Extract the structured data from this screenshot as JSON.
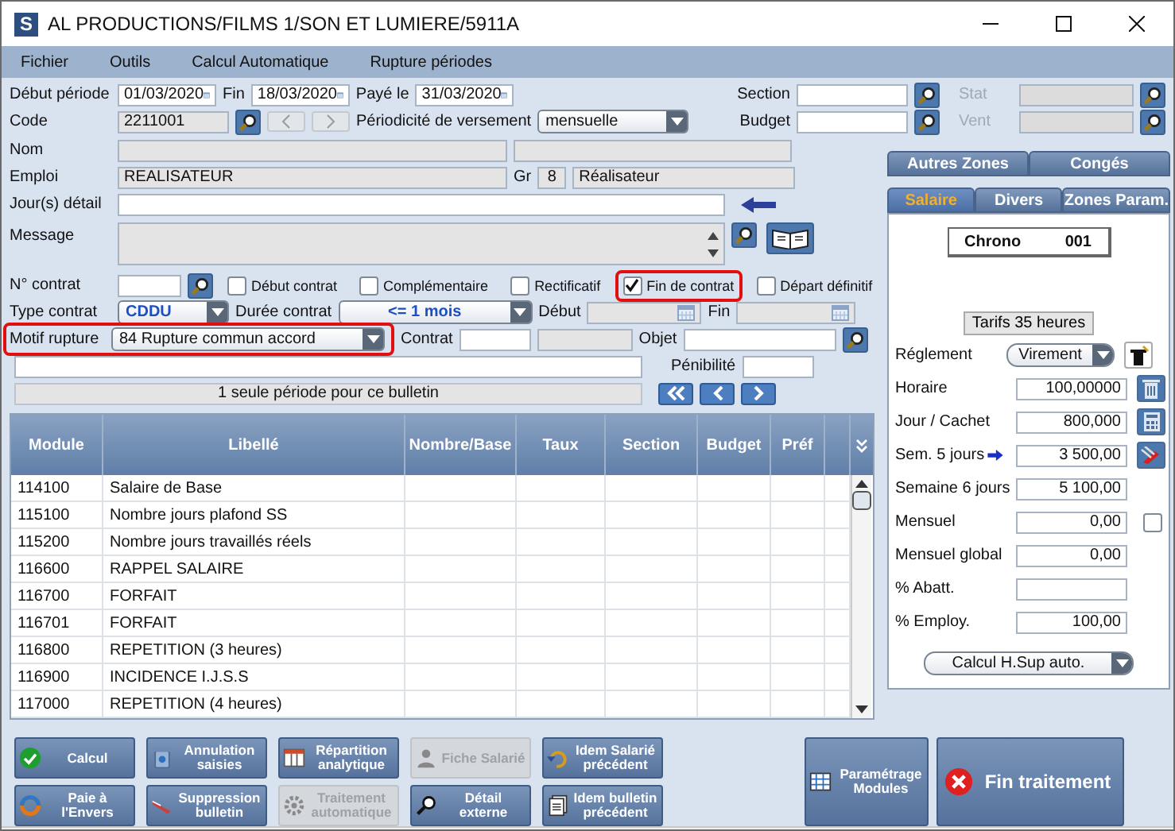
{
  "window": {
    "title": "AL PRODUCTIONS/FILMS 1/SON ET LUMIERE/5911A",
    "app_icon": "S"
  },
  "menu": [
    "Fichier",
    "Outils",
    "Calcul Automatique",
    "Rupture périodes"
  ],
  "periode": {
    "debut_label": "Début période",
    "debut": "01/03/2020",
    "fin_label": "Fin",
    "fin": "18/03/2020",
    "paye_label": "Payé le",
    "paye": "31/03/2020"
  },
  "code": {
    "label": "Code",
    "value": "2211001"
  },
  "periodicite": {
    "label": "Périodicité de versement",
    "value": "mensuelle"
  },
  "section": {
    "label": "Section"
  },
  "stat": {
    "label": "Stat",
    "disabled": true
  },
  "budget": {
    "label": "Budget"
  },
  "vent": {
    "label": "Vent",
    "disabled": true
  },
  "nom_label": "Nom",
  "emploi": {
    "label": "Emploi",
    "value": "REALISATEUR",
    "gr_label": "Gr",
    "gr": "8",
    "description": "Réalisateur"
  },
  "jours_label": "Jour(s) détail",
  "message_label": "Message",
  "contrat_label": "N° contrat",
  "checkboxes": [
    {
      "label": "Début contrat",
      "checked": false,
      "highlighted": false
    },
    {
      "label": "Complémentaire",
      "checked": false,
      "highlighted": false
    },
    {
      "label": "Rectificatif",
      "checked": false,
      "highlighted": false
    },
    {
      "label": "Fin de contrat",
      "checked": true,
      "highlighted": true
    },
    {
      "label": "Départ définitif",
      "checked": false,
      "highlighted": false
    }
  ],
  "type_contrat": {
    "label": "Type contrat",
    "value": "CDDU"
  },
  "duree": {
    "label": "Durée contrat",
    "value": "<= 1 mois"
  },
  "debut_label": "Début",
  "fin_label": "Fin",
  "motif": {
    "label": "Motif rupture",
    "value": "84 Rupture commun accord",
    "highlighted": true
  },
  "contrat_label2": "Contrat",
  "objet_label": "Objet",
  "penibilite_label": "Pénibilité",
  "period_info": "1 seule période pour ce bulletin",
  "table": {
    "columns": [
      "Module",
      "Libellé",
      "Nombre/Base",
      "Taux",
      "Section",
      "Budget",
      "Préf"
    ],
    "rows": [
      [
        "114100",
        "Salaire de Base"
      ],
      [
        "115100",
        "Nombre jours plafond SS"
      ],
      [
        "115200",
        "Nombre jours travaillés réels"
      ],
      [
        "116600",
        "RAPPEL SALAIRE"
      ],
      [
        "116700",
        "FORFAIT"
      ],
      [
        "116701",
        "FORFAIT"
      ],
      [
        "116800",
        "REPETITION (3 heures)"
      ],
      [
        "116900",
        "INCIDENCE I.J.S.S"
      ],
      [
        "117000",
        "REPETITION (4 heures)"
      ]
    ]
  },
  "tabs_top": [
    {
      "label": "Autres Zones",
      "selected": false
    },
    {
      "label": "Congés",
      "selected": false
    }
  ],
  "tabs": [
    {
      "label": "Salaire",
      "selected": true
    },
    {
      "label": "Divers",
      "selected": false
    },
    {
      "label": "Zones Param.",
      "selected": false
    }
  ],
  "chrono": {
    "label": "Chrono",
    "value": "001"
  },
  "tarifs": "Tarifs 35 heures",
  "reglement": {
    "label": "Réglement",
    "value": "Virement"
  },
  "salary_fields": [
    {
      "label": "Horaire",
      "value": "100,00000",
      "arrow": false,
      "kind": "trash"
    },
    {
      "label": "Jour / Cachet",
      "value": "800,000",
      "arrow": false,
      "kind": "calculator"
    },
    {
      "label": "Sem. 5 jours",
      "value": "3 500,00",
      "arrow": true,
      "kind": "tools"
    },
    {
      "label": "Semaine 6 jours",
      "value": "5 100,00",
      "arrow": false,
      "kind": "none"
    },
    {
      "label": "Mensuel",
      "value": "0,00",
      "arrow": false,
      "kind": "checkbox",
      "checked": false
    },
    {
      "label": "Mensuel global",
      "value": "0,00",
      "arrow": false,
      "kind": "none"
    },
    {
      "label": "% Abatt.",
      "arrow": false,
      "kind": "none"
    },
    {
      "label": "% Employ.",
      "value": "100,00",
      "arrow": false,
      "kind": "none"
    }
  ],
  "calc_hsup": "Calcul H.Sup auto.",
  "buttons": [
    {
      "label": "Calcul",
      "kind": "check",
      "disabled": false
    },
    {
      "label": "Annulation saisies",
      "kind": "bin",
      "disabled": false
    },
    {
      "label": "Répartition analytique",
      "kind": "grid",
      "disabled": false
    },
    {
      "label": "Fiche Salarié",
      "kind": "person",
      "disabled": true
    },
    {
      "label": "Idem Salarié précédent",
      "kind": "undo",
      "disabled": false
    },
    {
      "label": "Paie à l'Envers",
      "kind": "ring",
      "disabled": false
    },
    {
      "label": "Suppression bulletin",
      "kind": "eraser",
      "disabled": false
    },
    {
      "label": "Traitement automatique",
      "kind": "gear",
      "disabled": true
    },
    {
      "label": "Détail externe",
      "kind": "search",
      "disabled": false
    },
    {
      "label": "Idem bulletin précédent",
      "kind": "doc",
      "disabled": false
    }
  ],
  "param_button": "Paramétrage Modules",
  "fin_button": "Fin traitement"
}
